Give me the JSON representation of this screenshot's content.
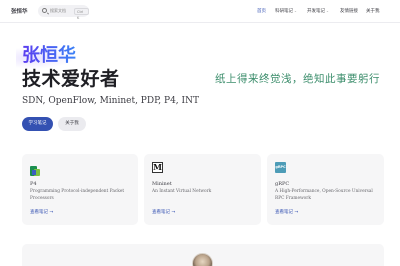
{
  "brand": "张恒华",
  "search": {
    "placeholder": "搜索文档",
    "shortcut": "Ctrl K"
  },
  "nav": {
    "items": [
      {
        "label": "首页",
        "active": true
      },
      {
        "label": "科研笔记",
        "dropdown": true
      },
      {
        "label": "开发笔记",
        "dropdown": true
      },
      {
        "label": "友情链接"
      },
      {
        "label": "关于我"
      }
    ],
    "theme_icon": "sun-icon"
  },
  "hero": {
    "name": "张恒华",
    "text": "技术爱好者",
    "tagline": "SDN, OpenFlow, Mininet, PDP, P4, INT",
    "quote": "纸上得来终觉浅，绝知此事要躬行",
    "buttons": {
      "primary": "学习笔记",
      "alt": "关于我"
    }
  },
  "features": [
    {
      "icon": "p4-logo-icon",
      "title": "P4",
      "desc": "Programming Protocol-independent Packet Processors",
      "link": "查看笔记"
    },
    {
      "icon": "mininet-logo-icon",
      "title": "Mininet",
      "desc": "An Instant Virtual Network",
      "link": "查看笔记"
    },
    {
      "icon": "grpc-logo-icon",
      "title": "gRPC",
      "desc": "A High-Performance, Open-Source Universal RPC Framework",
      "link": "查看笔记"
    }
  ],
  "colors": {
    "brand": "#3451b2",
    "quote": "#3b8d6b",
    "card_bg": "#f6f6f7"
  }
}
